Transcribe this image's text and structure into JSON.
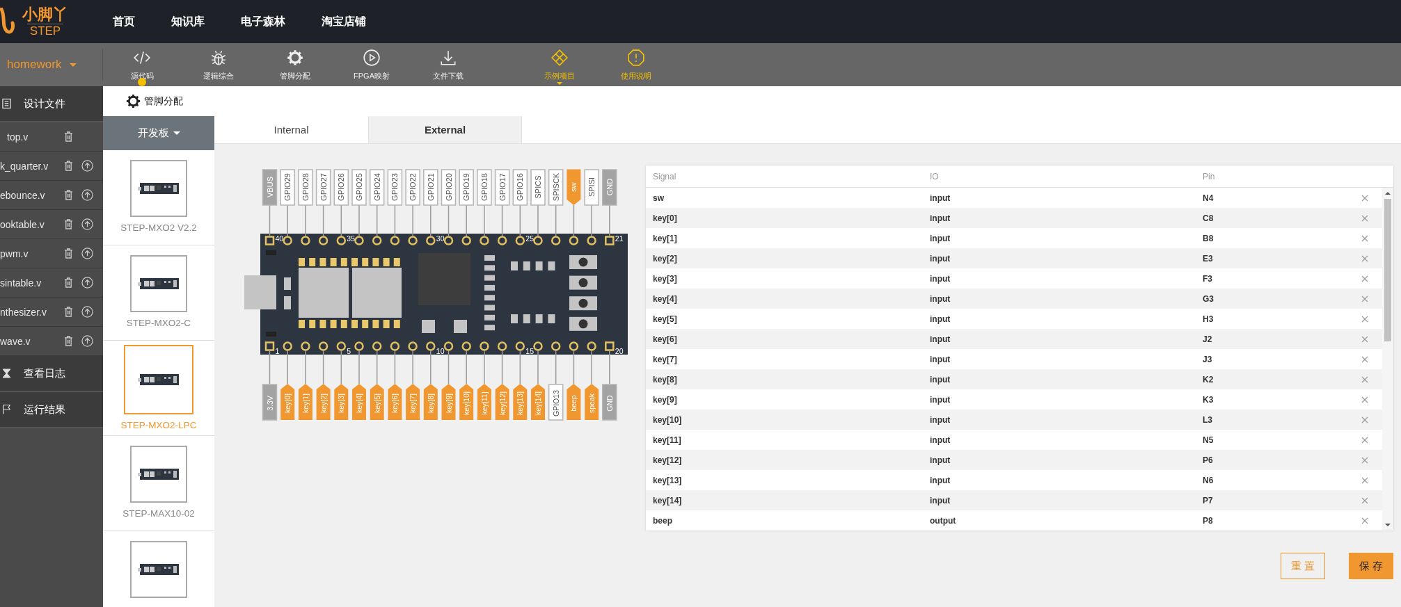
{
  "logo": {
    "title": "小脚丫",
    "subtitle": "STEP"
  },
  "nav": [
    "首页",
    "知识库",
    "电子森林",
    "淘宝店铺"
  ],
  "project": {
    "name": "homework"
  },
  "tools": [
    {
      "label": "源代码",
      "kind": "normal",
      "selected": true,
      "dropdown": false
    },
    {
      "label": "逻辑综合",
      "kind": "normal",
      "selected": false,
      "dropdown": false
    },
    {
      "label": "管脚分配",
      "kind": "normal",
      "selected": false,
      "dropdown": false
    },
    {
      "label": "FPGA映射",
      "kind": "normal",
      "selected": false,
      "dropdown": false
    },
    {
      "label": "文件下载",
      "kind": "normal",
      "selected": false,
      "dropdown": false
    },
    {
      "label": "示例项目",
      "kind": "accent",
      "selected": false,
      "dropdown": true
    },
    {
      "label": "使用说明",
      "kind": "accent",
      "selected": false,
      "dropdown": false
    }
  ],
  "design_files": {
    "title": "设计文件",
    "files": [
      {
        "name": "top.v",
        "uploadable": false
      },
      {
        "name": "k_quarter.v",
        "uploadable": true
      },
      {
        "name": "ebounce.v",
        "uploadable": true
      },
      {
        "name": "ooktable.v",
        "uploadable": true
      },
      {
        "name": "pwm.v",
        "uploadable": true
      },
      {
        "name": "sintable.v",
        "uploadable": true
      },
      {
        "name": "nthesizer.v",
        "uploadable": true
      },
      {
        "name": "wave.v",
        "uploadable": true
      }
    ]
  },
  "log": {
    "title": "查看日志"
  },
  "results": {
    "title": "运行结果"
  },
  "page_title": "管脚分配",
  "boards": {
    "title": "开发板",
    "items": [
      {
        "label": "STEP-MXO2 V2.2",
        "selected": false
      },
      {
        "label": "STEP-MXO2-C",
        "selected": false
      },
      {
        "label": "STEP-MXO2-LPC",
        "selected": true
      },
      {
        "label": "STEP-MAX10-02",
        "selected": false
      },
      {
        "selected": false
      }
    ]
  },
  "tabs": [
    {
      "label": "Internal",
      "selected": false
    },
    {
      "label": "External",
      "selected": true
    }
  ],
  "pins": {
    "top": [
      {
        "label": "VBUS",
        "kind": "power",
        "number": "40"
      },
      {
        "label": "GPIO29",
        "kind": "free"
      },
      {
        "label": "GPIO28",
        "kind": "free"
      },
      {
        "label": "GPIO27",
        "kind": "free"
      },
      {
        "label": "GPIO26",
        "kind": "free",
        "number": "35"
      },
      {
        "label": "GPIO25",
        "kind": "free"
      },
      {
        "label": "GPIO24",
        "kind": "free"
      },
      {
        "label": "GPIO23",
        "kind": "free"
      },
      {
        "label": "GPIO22",
        "kind": "free"
      },
      {
        "label": "GPIO21",
        "kind": "free",
        "number": "30"
      },
      {
        "label": "GPIO20",
        "kind": "free"
      },
      {
        "label": "GPIO19",
        "kind": "free"
      },
      {
        "label": "GPIO18",
        "kind": "free"
      },
      {
        "label": "GPIO17",
        "kind": "free"
      },
      {
        "label": "GPIO16",
        "kind": "free",
        "number": "25"
      },
      {
        "label": "SPICS",
        "kind": "free"
      },
      {
        "label": "SPISCK",
        "kind": "free"
      },
      {
        "label": "sw",
        "kind": "signal"
      },
      {
        "label": "SPISI",
        "kind": "free"
      },
      {
        "label": "GND",
        "kind": "power",
        "number": "21"
      }
    ],
    "bottom": [
      {
        "label": "3.3V",
        "kind": "power",
        "number": "1"
      },
      {
        "label": "key[0]",
        "kind": "signal"
      },
      {
        "label": "key[1]",
        "kind": "signal"
      },
      {
        "label": "key[2]",
        "kind": "signal"
      },
      {
        "label": "key[3]",
        "kind": "signal",
        "number": "5"
      },
      {
        "label": "key[4]",
        "kind": "signal"
      },
      {
        "label": "key[5]",
        "kind": "signal"
      },
      {
        "label": "key[6]",
        "kind": "signal"
      },
      {
        "label": "key[7]",
        "kind": "signal"
      },
      {
        "label": "key[8]",
        "kind": "signal",
        "number": "10"
      },
      {
        "label": "key[9]",
        "kind": "signal"
      },
      {
        "label": "key[10]",
        "kind": "signal"
      },
      {
        "label": "key[11]",
        "kind": "signal"
      },
      {
        "label": "key[12]",
        "kind": "signal"
      },
      {
        "label": "key[13]",
        "kind": "signal",
        "number": "15"
      },
      {
        "label": "key[14]",
        "kind": "signal"
      },
      {
        "label": "GPIO13",
        "kind": "free"
      },
      {
        "label": "beep",
        "kind": "signal"
      },
      {
        "label": "speak",
        "kind": "signal"
      },
      {
        "label": "GND",
        "kind": "power",
        "number": "20"
      }
    ]
  },
  "table": {
    "columns": [
      "Signal",
      "IO",
      "Pin"
    ],
    "rows": [
      {
        "signal": "sw",
        "io": "input",
        "pin": "N4"
      },
      {
        "signal": "key[0]",
        "io": "input",
        "pin": "C8"
      },
      {
        "signal": "key[1]",
        "io": "input",
        "pin": "B8"
      },
      {
        "signal": "key[2]",
        "io": "input",
        "pin": "E3"
      },
      {
        "signal": "key[3]",
        "io": "input",
        "pin": "F3"
      },
      {
        "signal": "key[4]",
        "io": "input",
        "pin": "G3"
      },
      {
        "signal": "key[5]",
        "io": "input",
        "pin": "H3"
      },
      {
        "signal": "key[6]",
        "io": "input",
        "pin": "J2"
      },
      {
        "signal": "key[7]",
        "io": "input",
        "pin": "J3"
      },
      {
        "signal": "key[8]",
        "io": "input",
        "pin": "K2"
      },
      {
        "signal": "key[9]",
        "io": "input",
        "pin": "K3"
      },
      {
        "signal": "key[10]",
        "io": "input",
        "pin": "L3"
      },
      {
        "signal": "key[11]",
        "io": "input",
        "pin": "N5"
      },
      {
        "signal": "key[12]",
        "io": "input",
        "pin": "P6"
      },
      {
        "signal": "key[13]",
        "io": "input",
        "pin": "N6"
      },
      {
        "signal": "key[14]",
        "io": "input",
        "pin": "P7"
      },
      {
        "signal": "beep",
        "io": "output",
        "pin": "P8"
      }
    ]
  },
  "buttons": [
    {
      "label": "重 置",
      "kind": "secondary"
    },
    {
      "label": "保 存",
      "kind": "primary"
    }
  ]
}
